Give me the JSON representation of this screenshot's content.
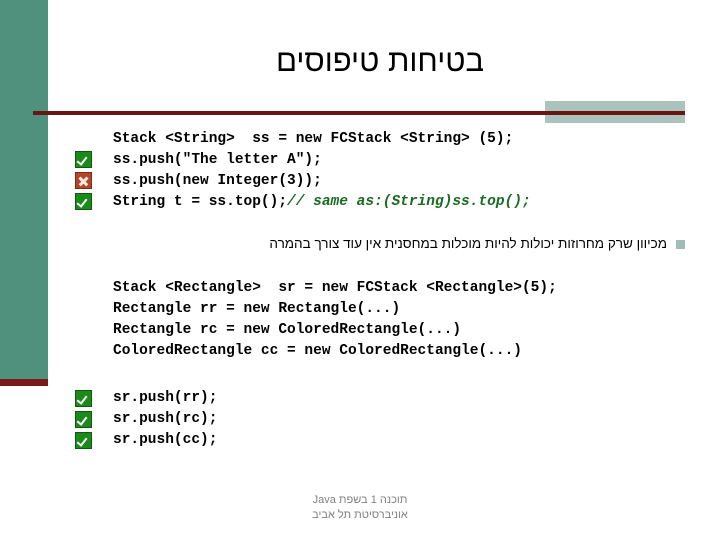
{
  "slide": {
    "title": "בטיחות טיפוסים",
    "accent_teal": "#4f917c",
    "accent_dark_red": "#6b1414",
    "accent_sage": "#aac4bd",
    "comment_green": "#1a6b22"
  },
  "code_block_1": {
    "lines": [
      "Stack <String>  ss = new FCStack <String> (5);",
      "ss.push(\"The letter A\");",
      "ss.push(new Integer(3));",
      "String t = ss.top();"
    ],
    "inline_comment": "// same as:(String)ss.top();",
    "markers": [
      "check",
      "broken-image",
      "check"
    ]
  },
  "bullet": {
    "marker": "square-bullet",
    "text": "מכיוון שרק מחרוזות יכולות להיות מוכלות במחסנית אין עוד צורך בהמרה"
  },
  "code_block_2": {
    "lines": [
      "Stack <Rectangle>  sr = new FCStack <Rectangle>(5);",
      "Rectangle rr = new Rectangle(...)",
      "Rectangle rc = new ColoredRectangle(...)",
      "ColoredRectangle cc = new ColoredRectangle(...)"
    ]
  },
  "code_block_3": {
    "lines": [
      "sr.push(rr);",
      "sr.push(rc);",
      "sr.push(cc);"
    ],
    "markers": [
      "check",
      "check",
      "check"
    ]
  },
  "footer": {
    "line1": "תוכנה 1 בשפת Java",
    "line2": "אוניברסיטת תל אביב"
  }
}
